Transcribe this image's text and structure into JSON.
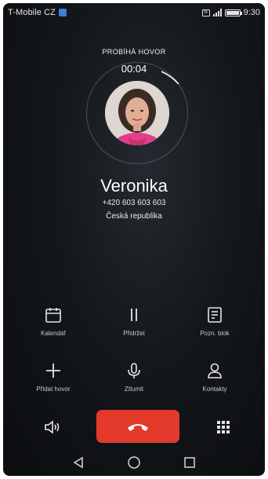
{
  "status_bar": {
    "carrier": "T-Mobile CZ",
    "time": "9:30"
  },
  "call": {
    "status": "PROBÍHÁ HOVOR",
    "timer": "00:04",
    "name": "Veronika",
    "number": "+420 603 603 603",
    "country": "Česká republika"
  },
  "actions": {
    "calendar": "Kalendář",
    "hold": "Přidržet",
    "notes": "Pozn. blok",
    "add_call": "Přidat hovor",
    "mute": "Ztlumit",
    "contacts": "Kontakty"
  },
  "icons": {
    "calendar": "calendar-icon",
    "hold": "pause-icon",
    "notes": "notepad-icon",
    "add_call": "plus-icon",
    "mute": "microphone-icon",
    "contacts": "person-icon",
    "speaker": "speaker-icon",
    "end_call": "phone-hangup-icon",
    "dialpad": "dialpad-icon",
    "back": "back-icon",
    "home": "home-icon",
    "recents": "recents-icon"
  },
  "colors": {
    "end_call": "#e33a2c",
    "carrier_badge": "#3d7fd6"
  }
}
